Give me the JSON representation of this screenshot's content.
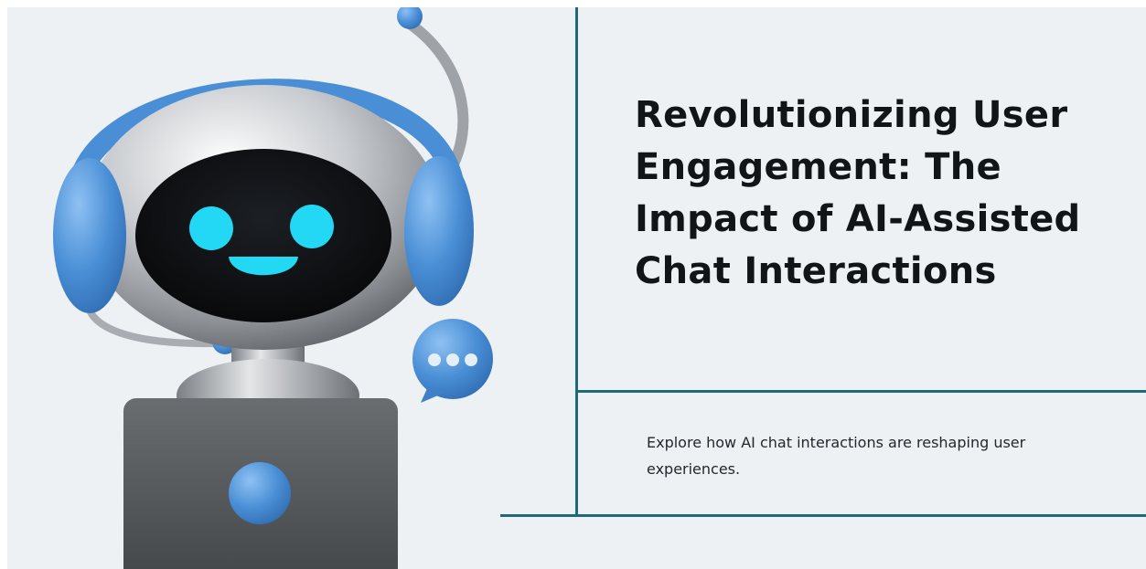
{
  "slide": {
    "title": "Revolutionizing User Engagement: The Impact of AI-Assisted Chat Interactions",
    "subtitle": "Explore how AI chat interactions are reshaping user experiences."
  },
  "illustration": {
    "subject": "robot-with-headset-illustration",
    "chat_bubble_icon": "chat-bubble-ellipsis-icon"
  },
  "colors": {
    "background": "#edf1f3",
    "accent_line": "#1f6a78",
    "headset_blue": "#4a8fd6",
    "face_glow": "#22d8f5",
    "title_text": "#111518"
  }
}
